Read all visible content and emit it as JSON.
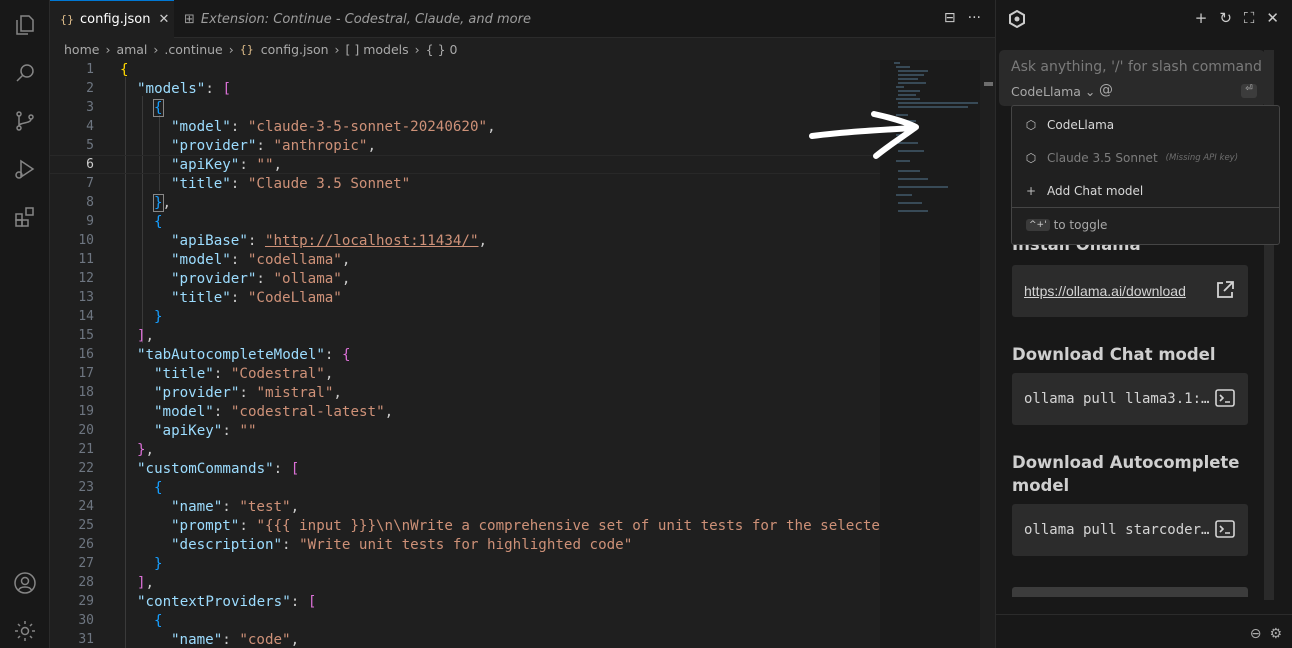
{
  "tabs": {
    "active": {
      "icon": "{}",
      "label": "config.json",
      "close": "✕"
    },
    "inactive": {
      "label": "Extension: Continue - Codestral, Claude, and more"
    },
    "actions": {
      "split": "⊟",
      "more": "···"
    }
  },
  "breadcrumb": [
    "home",
    "amal",
    ".continue",
    "config.json",
    "[ ] models",
    "{ } 0"
  ],
  "breadcrumb_icon": "{}",
  "line_numbers": [
    "1",
    "2",
    "3",
    "4",
    "5",
    "6",
    "7",
    "8",
    "9",
    "10",
    "11",
    "12",
    "13",
    "14",
    "15",
    "16",
    "17",
    "18",
    "19",
    "20",
    "21",
    "22",
    "23",
    "24",
    "25",
    "26",
    "27",
    "28",
    "29",
    "30",
    "31"
  ],
  "code": {
    "l1": "{",
    "l2k": "\"models\"",
    "l2p": ": ",
    "l2b": "[",
    "l3b": "{",
    "l4k": "\"model\"",
    "l4p": ": ",
    "l4s": "\"claude-3-5-sonnet-20240620\"",
    "l4c": ",",
    "l5k": "\"provider\"",
    "l5p": ": ",
    "l5s": "\"anthropic\"",
    "l5c": ",",
    "l6k": "\"apiKey\"",
    "l6p": ": ",
    "l6s": "\"\"",
    "l6c": ",",
    "l7k": "\"title\"",
    "l7p": ": ",
    "l7s": "\"Claude 3.5 Sonnet\"",
    "l8b": "}",
    "l8c": ",",
    "l9b": "{",
    "l10k": "\"apiBase\"",
    "l10p": ": ",
    "l10s": "\"http://localhost:11434/\"",
    "l10c": ",",
    "l11k": "\"model\"",
    "l11p": ": ",
    "l11s": "\"codellama\"",
    "l11c": ",",
    "l12k": "\"provider\"",
    "l12p": ": ",
    "l12s": "\"ollama\"",
    "l12c": ",",
    "l13k": "\"title\"",
    "l13p": ": ",
    "l13s": "\"CodeLlama\"",
    "l14b": "}",
    "l15b": "]",
    "l15c": ",",
    "l16k": "\"tabAutocompleteModel\"",
    "l16p": ": ",
    "l16b": "{",
    "l17k": "\"title\"",
    "l17p": ": ",
    "l17s": "\"Codestral\"",
    "l17c": ",",
    "l18k": "\"provider\"",
    "l18p": ": ",
    "l18s": "\"mistral\"",
    "l18c": ",",
    "l19k": "\"model\"",
    "l19p": ": ",
    "l19s": "\"codestral-latest\"",
    "l19c": ",",
    "l20k": "\"apiKey\"",
    "l20p": ": ",
    "l20s": "\"\"",
    "l21b": "}",
    "l21c": ",",
    "l22k": "\"customCommands\"",
    "l22p": ": ",
    "l22b": "[",
    "l23b": "{",
    "l24k": "\"name\"",
    "l24p": ": ",
    "l24s": "\"test\"",
    "l24c": ",",
    "l25k": "\"prompt\"",
    "l25p": ": ",
    "l25s": "\"{{{ input }}}\\n\\nWrite a comprehensive set of unit tests for the selected",
    "l26k": "\"description\"",
    "l26p": ": ",
    "l26s": "\"Write unit tests for highlighted code\"",
    "l27b": "}",
    "l28b": "]",
    "l28c": ",",
    "l29k": "\"contextProviders\"",
    "l29p": ": ",
    "l29b": "[",
    "l30b": "{",
    "l31k": "\"name\"",
    "l31p": ": ",
    "l31s": "\"code\"",
    "l31c": ","
  },
  "panel": {
    "input_placeholder": "Ask anything, '/' for slash commands, '@",
    "model_selector": "CodeLlama ⌄",
    "at_symbol": "@",
    "enter_symbol": "⏎",
    "header_actions": {
      "new": "+",
      "history": "↻",
      "fullscreen": "⛶",
      "close": "✕"
    },
    "dropdown": {
      "items": [
        {
          "label": "CodeLlama",
          "note": ""
        },
        {
          "label": "Claude 3.5 Sonnet",
          "note": "(Missing API key)"
        },
        {
          "label": "Add Chat model",
          "note": ""
        }
      ],
      "toggle_keys": "^+'",
      "toggle_label": "to toggle"
    },
    "setup": {
      "install_heading": "Install Ollama",
      "install_link": "https://ollama.ai/download",
      "chat_heading": "Download Chat model",
      "chat_cmd": "ollama pull llama3.1:…",
      "autocomplete_heading": "Download Autocomplete model",
      "autocomplete_cmd": "ollama pull starcoder…"
    },
    "footer": {
      "minus": "⊖",
      "gear": "⚙"
    }
  },
  "colors": {
    "key": "#9cdcfe",
    "string": "#ce9178",
    "bracket_gold": "#ffd700",
    "bracket_purple": "#da70d6",
    "bracket_blue": "#179fff",
    "accent": "#0078d4"
  }
}
